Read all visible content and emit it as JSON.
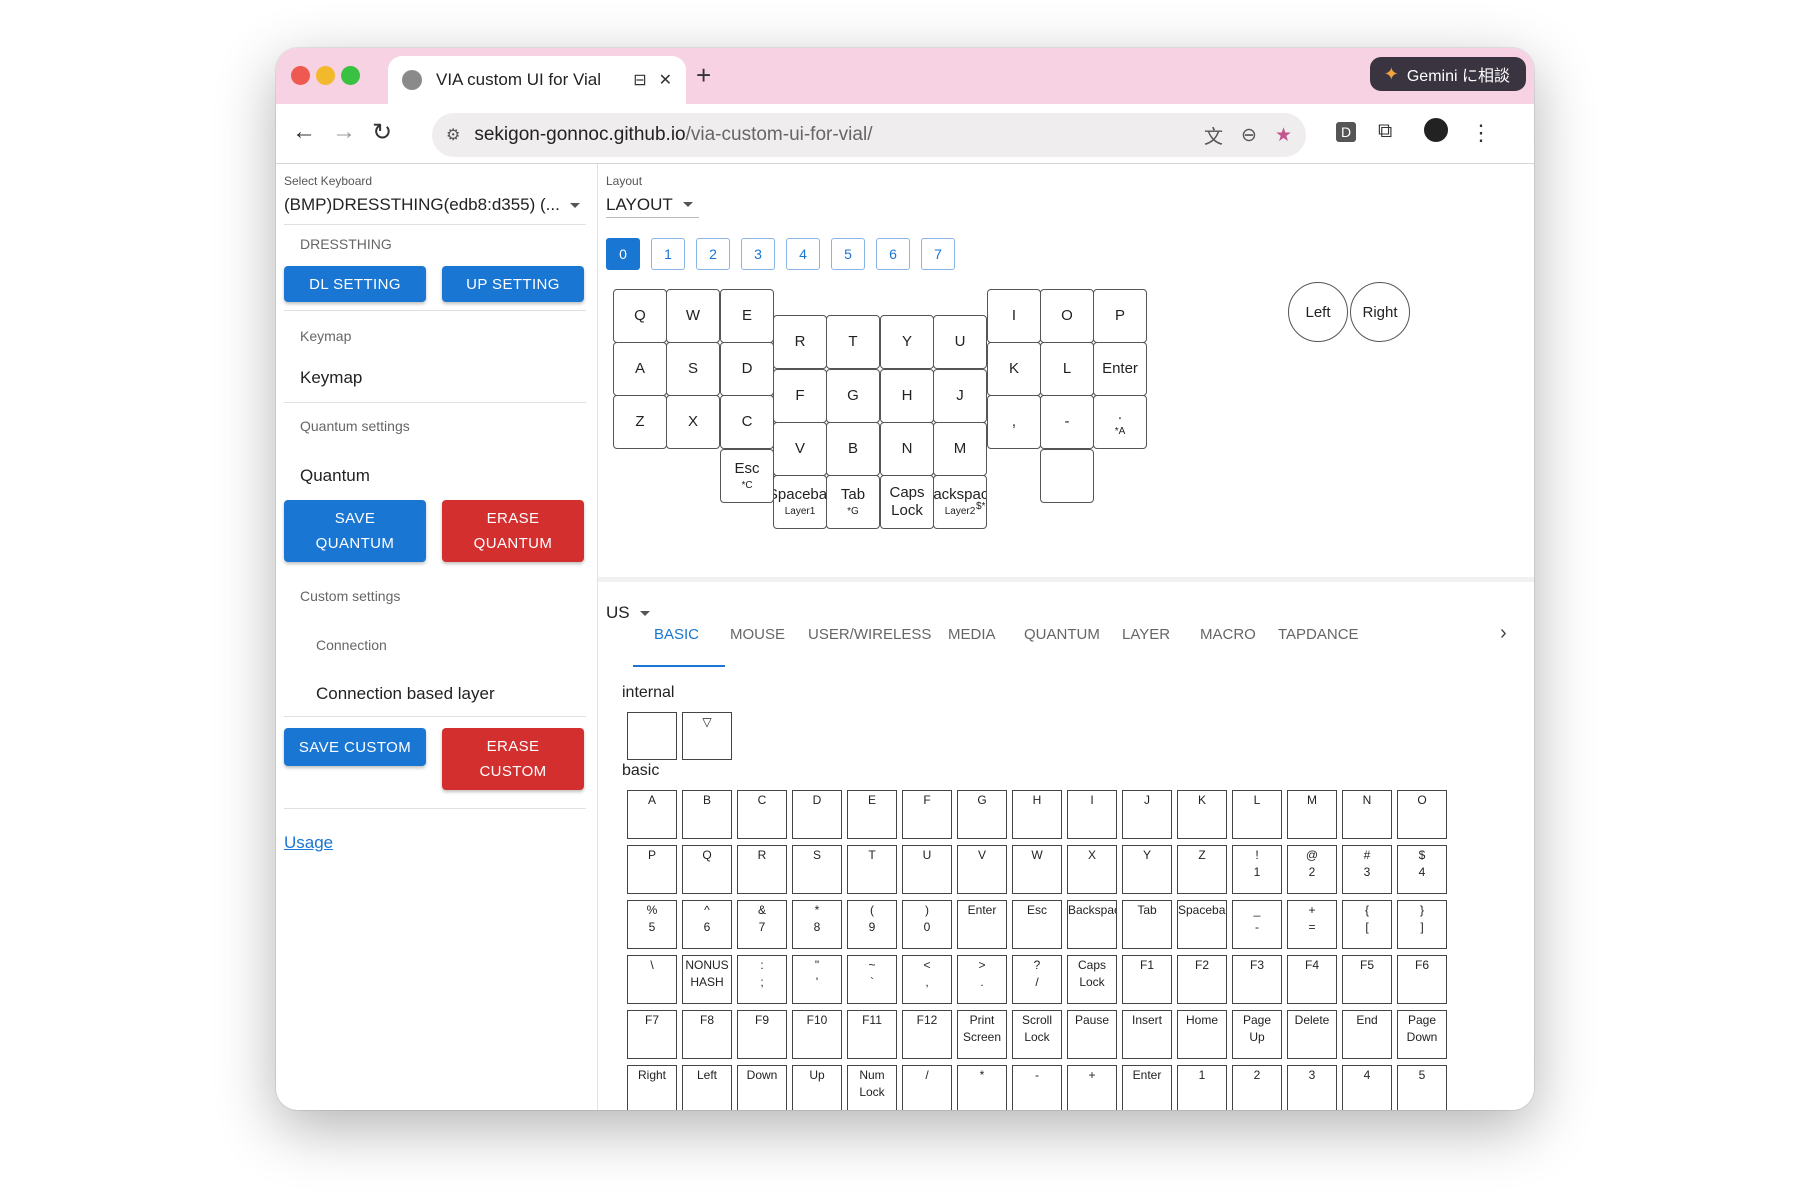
{
  "browser": {
    "tab_title": "VIA custom UI for Vial",
    "new_tab": "+",
    "gemini_label": "Gemini に相談",
    "url_host": "sekigon-gonnoc.github.io",
    "url_path": "/via-custom-ui-for-vial/",
    "profile_badge": "D",
    "menu_icon": "⋮"
  },
  "sidebar": {
    "select_keyboard_label": "Select Keyboard",
    "select_keyboard_value": "(BMP)DRESSTHING(edb8:d355) (...",
    "device_name": "DRESSTHING",
    "dl_setting": "DL SETTING",
    "up_setting": "UP SETTING",
    "keymap_label": "Keymap",
    "keymap_value": "Keymap",
    "quantum_label": "Quantum settings",
    "quantum_value": "Quantum",
    "save_quantum": "SAVE QUANTUM",
    "erase_quantum": "ERASE QUANTUM",
    "custom_label": "Custom settings",
    "connection_label": "Connection",
    "connection_value": "Connection based layer",
    "save_custom": "SAVE CUSTOM",
    "erase_custom": "ERASE CUSTOM",
    "usage_link": "Usage"
  },
  "layout": {
    "label": "Layout",
    "value": "LAYOUT",
    "layers": [
      "0",
      "1",
      "2",
      "3",
      "4",
      "5",
      "6",
      "7"
    ],
    "selected_layer": "0"
  },
  "keyboard_keys": [
    {
      "label": "Q",
      "sub": ""
    },
    {
      "label": "W",
      "sub": ""
    },
    {
      "label": "E",
      "sub": ""
    },
    {
      "label": "A",
      "sub": ""
    },
    {
      "label": "S",
      "sub": ""
    },
    {
      "label": "D",
      "sub": ""
    },
    {
      "label": "Z",
      "sub": ""
    },
    {
      "label": "X",
      "sub": ""
    },
    {
      "label": "C",
      "sub": ""
    },
    {
      "label": "Esc",
      "sub": "*C"
    },
    {
      "label": "R",
      "sub": ""
    },
    {
      "label": "T",
      "sub": ""
    },
    {
      "label": "Y",
      "sub": ""
    },
    {
      "label": "U",
      "sub": ""
    },
    {
      "label": "F",
      "sub": ""
    },
    {
      "label": "G",
      "sub": ""
    },
    {
      "label": "H",
      "sub": ""
    },
    {
      "label": "J",
      "sub": ""
    },
    {
      "label": "V",
      "sub": ""
    },
    {
      "label": "B",
      "sub": ""
    },
    {
      "label": "N",
      "sub": ""
    },
    {
      "label": "M",
      "sub": ""
    },
    {
      "label": "Spacebar",
      "sub": "Layer1"
    },
    {
      "label": "Tab",
      "sub": "*G"
    },
    {
      "label": "Caps\nLock",
      "sub": ""
    },
    {
      "label": "Backspace",
      "sub": "Layer2"
    },
    {
      "label": "I",
      "sub": ""
    },
    {
      "label": "O",
      "sub": ""
    },
    {
      "label": "P",
      "sub": ""
    },
    {
      "label": "K",
      "sub": ""
    },
    {
      "label": "L",
      "sub": ""
    },
    {
      "label": "Enter",
      "sub": ""
    },
    {
      "label": ",",
      "sub": ""
    },
    {
      "label": "-",
      "sub": ""
    },
    {
      "label": ".",
      "sub": "*A"
    },
    {
      "label": "",
      "sub": ""
    }
  ],
  "encoders": [
    "Left",
    "Right"
  ],
  "shift_mark": "$*",
  "keymap_lang": "US",
  "keycode_tabs": [
    "BASIC",
    "MOUSE",
    "USER/WIRELESS",
    "MEDIA",
    "QUANTUM",
    "LAYER",
    "MACRO",
    "TAPDANCE"
  ],
  "selected_tab": "BASIC",
  "tabs_next_icon": "›",
  "internal_label": "internal",
  "internal_keys": [
    "",
    "▽"
  ],
  "basic_label": "basic",
  "basic_keys": [
    "A",
    "B",
    "C",
    "D",
    "E",
    "F",
    "G",
    "H",
    "I",
    "J",
    "K",
    "L",
    "M",
    "N",
    "O",
    "P",
    "Q",
    "R",
    "S",
    "T",
    "U",
    "V",
    "W",
    "X",
    "Y",
    "Z",
    "!\n1",
    "@\n2",
    "#\n3",
    "$\n4",
    "%\n5",
    "^\n6",
    "&\n7",
    "*\n8",
    "(\n9",
    ")\n0",
    "Enter",
    "Esc",
    "Backspace",
    "Tab",
    "Spacebar",
    "_\n-",
    "+\n=",
    "{\n[",
    "}\n]",
    "\\",
    "NONUS\nHASH",
    ":\n;",
    "\"\n'",
    "~\n`",
    "<\n,",
    ">\n.",
    "?\n/",
    "Caps\nLock",
    "F1",
    "F2",
    "F3",
    "F4",
    "F5",
    "F6",
    "F7",
    "F8",
    "F9",
    "F10",
    "F11",
    "F12",
    "Print\nScreen",
    "Scroll\nLock",
    "Pause",
    "Insert",
    "Home",
    "Page\nUp",
    "Delete",
    "End",
    "Page\nDown",
    "Right",
    "Left",
    "Down",
    "Up",
    "Num\nLock",
    "/",
    "*",
    "-",
    "+",
    "Enter",
    "1",
    "2",
    "3",
    "4",
    "5"
  ]
}
